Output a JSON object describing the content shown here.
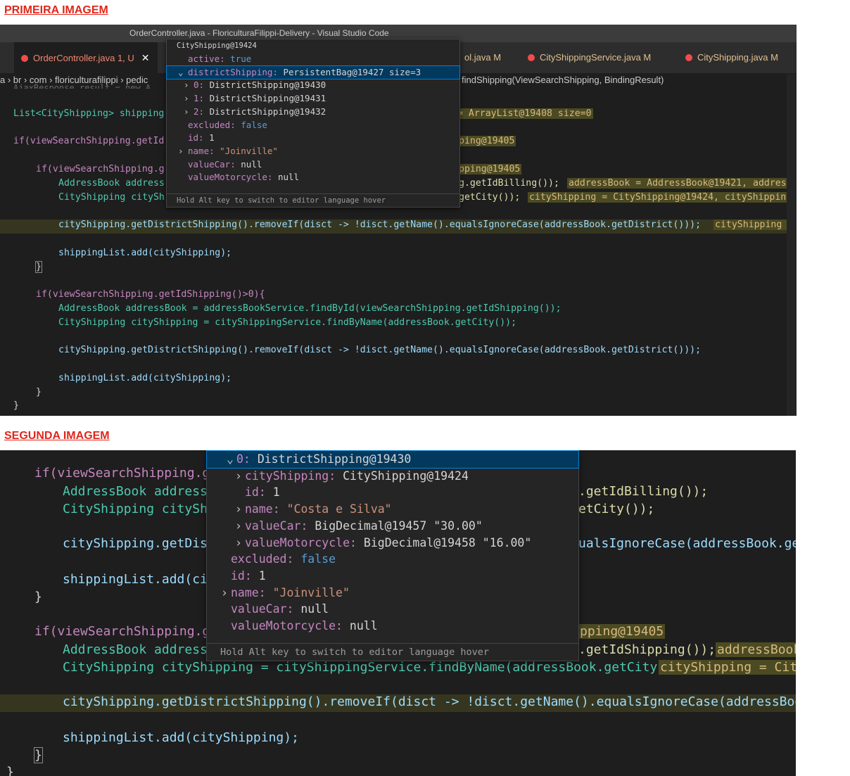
{
  "labels": {
    "first": "PRIMEIRA IMAGEM",
    "second": "SEGUNDA IMAGEM"
  },
  "window": {
    "title": "OrderController.java - FloriculturaFilippi-Delivery - Visual Studio Code"
  },
  "tabs": [
    {
      "label": "OrderController.java",
      "badge": "1, U",
      "close": "✕"
    },
    {
      "label": "ol.java",
      "badge": "M"
    },
    {
      "label": "CityShippingService.java",
      "badge": "M"
    },
    {
      "label": "CityShipping.java",
      "badge": "M"
    }
  ],
  "breadcrumb": {
    "left": "a › br › com › floriculturafilippi › pedic",
    "right": "findShipping(ViewSearchShipping, BindingResult)"
  },
  "hover1": {
    "title": "CityShipping@19424",
    "rows": [
      {
        "prop": "active: ",
        "val": "true",
        "kind": "kw",
        "chev": ""
      },
      {
        "prop": "districtShipping: ",
        "val": "PersistentBag@19427 size=3",
        "kind": "obj",
        "chev": "⌄"
      },
      {
        "prop": "0: ",
        "val": "DistrictShipping@19430",
        "kind": "obj",
        "chev": "›"
      },
      {
        "prop": "1: ",
        "val": "DistrictShipping@19431",
        "kind": "obj",
        "chev": "›"
      },
      {
        "prop": "2: ",
        "val": "DistrictShipping@19432",
        "kind": "obj",
        "chev": "›"
      },
      {
        "prop": "excluded: ",
        "val": "false",
        "kind": "kw",
        "chev": ""
      },
      {
        "prop": "id: ",
        "val": "1",
        "kind": "obj",
        "chev": ""
      },
      {
        "prop": "name: ",
        "val": "\"Joinville\"",
        "kind": "str",
        "chev": "›"
      },
      {
        "prop": "valueCar: ",
        "val": "null",
        "kind": "obj",
        "chev": ""
      },
      {
        "prop": "valueMotorcycle: ",
        "val": "null",
        "kind": "obj",
        "chev": ""
      }
    ],
    "footer": "Hold Alt key to switch to editor language hover"
  },
  "hover2": {
    "rows": [
      {
        "prop": "0: ",
        "val": "DistrictShipping@19430",
        "kind": "obj",
        "chev": "⌄"
      },
      {
        "prop": "cityShipping: ",
        "val": "CityShipping@19424",
        "kind": "obj",
        "chev": "›"
      },
      {
        "prop": "id: ",
        "val": "1",
        "kind": "obj",
        "chev": ""
      },
      {
        "prop": "name: ",
        "val": "\"Costa e Silva\"",
        "kind": "str",
        "chev": "›"
      },
      {
        "prop": "valueCar: ",
        "val": "BigDecimal@19457 \"30.00\"",
        "kind": "obj",
        "chev": "›"
      },
      {
        "prop": "valueMotorcycle: ",
        "val": "BigDecimal@19458 \"16.00\"",
        "kind": "obj",
        "chev": "›"
      },
      {
        "prop": "excluded: ",
        "val": "false",
        "kind": "kw",
        "chev": ""
      },
      {
        "prop": "id: ",
        "val": "1",
        "kind": "obj",
        "chev": ""
      },
      {
        "prop": "name: ",
        "val": "\"Joinville\"",
        "kind": "str",
        "chev": "›"
      },
      {
        "prop": "valueCar: ",
        "val": "null",
        "kind": "obj",
        "chev": ""
      },
      {
        "prop": "valueMotorcycle: ",
        "val": "null",
        "kind": "obj",
        "chev": ""
      }
    ],
    "footer": "Hold Alt key to switch to editor language hover"
  },
  "code1": {
    "l0": "AjaxResponse result = new A",
    "l1a": "List<CityShipping> shipping",
    "l1b": "= ArrayList@19408 size=0",
    "l2a": "if(viewSearchShipping.getId",
    "l2b": "ping@19405",
    "l3a": "if(viewSearchShipping.g",
    "l3b": "pping@19405",
    "l4a": "AddressBook address",
    "l4b": "g.getIdBilling());",
    "l4c": "addressBook = AddressBook@19421, addressB",
    "l5a": "CityShipping citySh",
    "l5b": "getCity());",
    "l5c": "cityShipping = CityShipping@19424, cityShipping",
    "l6": "cityShipping.getDistrictShipping().removeIf(disct -> !disct.getName().equalsIgnoreCase(addressBook.getDistrict()));",
    "l6c": "cityShipping =",
    "l7": "shippingList.add(cityShipping);",
    "l8": "}",
    "l9": "if(viewSearchShipping.getIdShipping()>0){",
    "l10": "AddressBook addressBook = addressBookService.findById(viewSearchShipping.getIdShipping());",
    "l11": "CityShipping cityShipping = cityShippingService.findByName(addressBook.getCity());",
    "l12": "cityShipping.getDistrictShipping().removeIf(disct -> !disct.getName().equalsIgnoreCase(addressBook.getDistrict()));",
    "l13": "shippingList.add(cityShipping);",
    "l14": "}",
    "l15": "}"
  },
  "code2": {
    "l1a": "if(viewSearchShipping.ge",
    "l2a": "AddressBook addressB",
    "l2b": ".getIdBilling());",
    "l3a": "CityShipping cityShi",
    "l3b": "etCity());",
    "l4a": "cityShipping.getDist",
    "l4b": "ualsIgnoreCase(addressBook.getD",
    "l5a": "shippingList.add(cit",
    "l6": "}",
    "l7a": "if(viewSearchShipping.ge",
    "l7b": "pping@19405",
    "l8a": "AddressBook addressB",
    "l8b": ".getIdShipping());",
    "l8c": "addressBook",
    "l9": "CityShipping cityShipping = cityShippingService.findByName(addressBook.getCity());",
    "l9c": "cityShipping = City",
    "l10": "cityShipping.getDistrictShipping().removeIf(disct -> !disct.getName().equalsIgnoreCase(addressBook.getD",
    "l11": "shippingList.add(cityShipping);",
    "l12": "}",
    "l13": "}"
  }
}
